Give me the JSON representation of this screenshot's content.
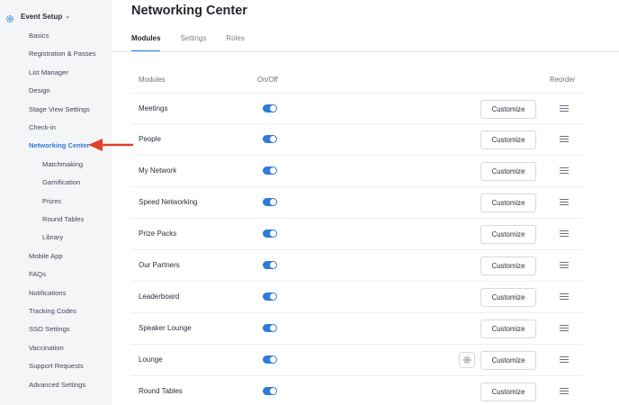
{
  "sidebar": {
    "header": "Event Setup",
    "items": [
      {
        "label": "Basics"
      },
      {
        "label": "Registration & Passes"
      },
      {
        "label": "List Manager"
      },
      {
        "label": "Design"
      },
      {
        "label": "Stage View Settings"
      },
      {
        "label": "Check-in"
      },
      {
        "label": "Networking Center"
      },
      {
        "label": "Matchmaking"
      },
      {
        "label": "Gamification"
      },
      {
        "label": "Prizes"
      },
      {
        "label": "Round Tables"
      },
      {
        "label": "Library"
      },
      {
        "label": "Mobile App"
      },
      {
        "label": "FAQs"
      },
      {
        "label": "Notifications"
      },
      {
        "label": "Tracking Codes"
      },
      {
        "label": "SSO Settings"
      },
      {
        "label": "Vaccination"
      },
      {
        "label": "Support Requests"
      },
      {
        "label": "Advanced Settings"
      }
    ],
    "active_item": "Networking Center"
  },
  "header": {
    "title": "Networking Center"
  },
  "tabs": [
    {
      "label": "Modules",
      "active": true
    },
    {
      "label": "Settings",
      "active": false
    },
    {
      "label": "Roles",
      "active": false
    }
  ],
  "table": {
    "columns": {
      "modules": "Modules",
      "onoff": "On/Off",
      "reorder": "Reorder"
    },
    "customize_label": "Customize",
    "rows": [
      {
        "name": "Meetings",
        "on": true
      },
      {
        "name": "People",
        "on": true
      },
      {
        "name": "My Network",
        "on": true
      },
      {
        "name": "Speed Networking",
        "on": true
      },
      {
        "name": "Prize Packs",
        "on": true
      },
      {
        "name": "Our Partners",
        "on": true
      },
      {
        "name": "Leaderboard",
        "on": true
      },
      {
        "name": "Speaker Lounge",
        "on": true
      },
      {
        "name": "Lounge",
        "on": true
      },
      {
        "name": "Round Tables",
        "on": true
      }
    ]
  },
  "icons": {
    "header": "gear-icon",
    "header_expand": "chevron-down-icon",
    "row_settings": "gear-icon",
    "reorder": "drag-handle-icon",
    "annotation": "red-arrow-icon"
  },
  "colors": {
    "accent": "#2f7bd8",
    "annotation": "#e0402a",
    "sidebar_bg": "#f4f5f7"
  }
}
